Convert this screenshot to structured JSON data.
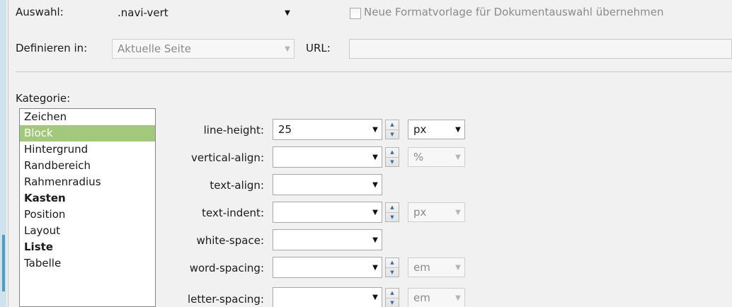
{
  "header": {
    "auswahl_label": "Auswahl:",
    "auswahl_value": ".navi-vert",
    "checkbox_label": "Neue Formatvorlage für Dokumentauswahl übernehmen",
    "definieren_label": "Definieren in:",
    "definieren_value": "Aktuelle Seite",
    "url_label": "URL:",
    "url_value": ""
  },
  "kategorie": {
    "label": "Kategorie:",
    "items": [
      {
        "label": "Zeichen"
      },
      {
        "label": "Block"
      },
      {
        "label": "Hintergrund"
      },
      {
        "label": "Randbereich"
      },
      {
        "label": "Rahmenradius"
      },
      {
        "label": "Kasten"
      },
      {
        "label": "Position"
      },
      {
        "label": "Layout"
      },
      {
        "label": "Liste"
      },
      {
        "label": "Tabelle"
      }
    ],
    "selected": "Block"
  },
  "properties": [
    {
      "label": "line-height:",
      "value": "25",
      "unit": "px"
    },
    {
      "label": "vertical-align:",
      "value": "",
      "unit": "%"
    },
    {
      "label": "text-align:",
      "value": ""
    },
    {
      "label": "text-indent:",
      "value": "",
      "unit": "px"
    },
    {
      "label": "white-space:",
      "value": ""
    },
    {
      "label": "word-spacing:",
      "value": "",
      "unit": "em"
    },
    {
      "label": "letter-spacing:",
      "value": "",
      "unit": "em"
    }
  ],
  "colors": {
    "selection": "#a2c87c",
    "spinner_arrow": "#3a6ca8"
  },
  "icons": {
    "dropdown": "triangle-down",
    "spinner": "up-down-arrows"
  }
}
